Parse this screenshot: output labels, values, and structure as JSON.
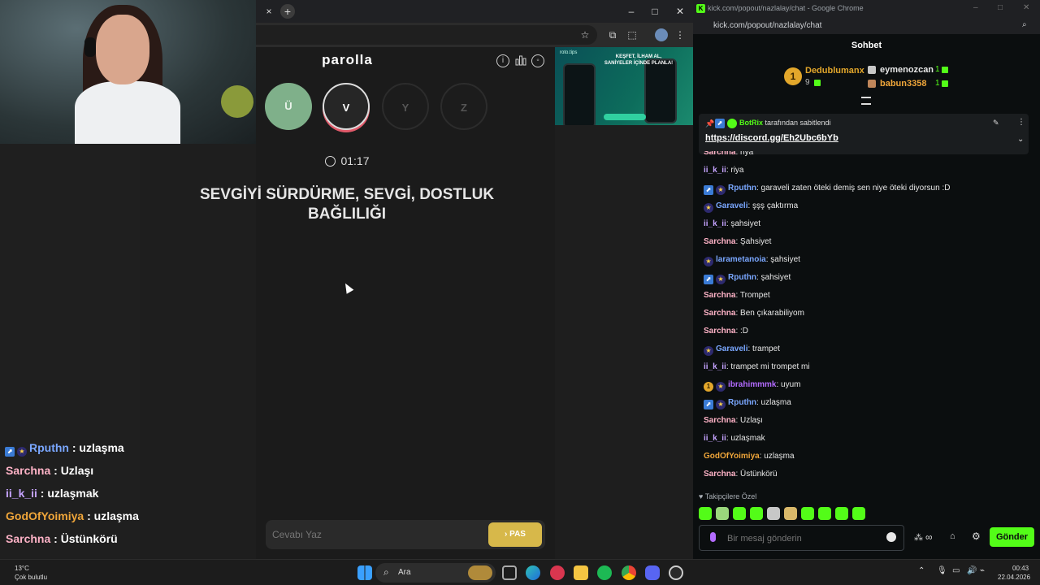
{
  "browser_left": {
    "tab_close": "×",
    "tab_new": "+",
    "win_min": "–",
    "win_max": "□",
    "win_close": "✕"
  },
  "parolla": {
    "title": "parolla",
    "letters": [
      "Ü",
      "V",
      "Y",
      "Z"
    ],
    "timer": "01:17",
    "question": "SEVGİYİ SÜRDÜRME, SEVGİ, DOSTLUK BAĞLILIĞI",
    "answer_placeholder": "Cevabı Yaz",
    "pas_label": "› PAS"
  },
  "ad": {
    "brand": "roto.tips",
    "title": "KEŞFET, İLHAM AL, SANİYELER İÇİNDE PLANLA!"
  },
  "overlay_chat": [
    {
      "user": "Rputhn",
      "text": " : uzlaşma",
      "color": "#7aa7ff"
    },
    {
      "user": "Sarchna",
      "text": " : Uzlaşı",
      "color": "#ffb3c7"
    },
    {
      "user": "ii_k_ii",
      "text": " : uzlaşmak",
      "color": "#c5a3ff"
    },
    {
      "user": "GodOfYoimiya",
      "text": " : uzlaşma",
      "color": "#f0a63a"
    },
    {
      "user": "Sarchna",
      "text": " : Üstünkörü",
      "color": "#ffb3c7"
    }
  ],
  "chat": {
    "window_title": "kick.com/popout/nazlalay/chat - Google Chrome",
    "url": "kick.com/popout/nazlalay/chat",
    "header": "Sohbet",
    "leaders": {
      "first": {
        "rank": "1",
        "name": "Dedublumanx",
        "count": "9"
      },
      "second": {
        "name": "eymenozcan",
        "count": "1"
      },
      "third": {
        "name": "babun3358",
        "count": "1"
      }
    },
    "pinned": {
      "by": "BotRix",
      "by_suffix": " tarafından sabitlendi",
      "link": "https://discord.gg/Eh2Ubc6bYb"
    },
    "messages": [
      {
        "user": "Sarchna",
        "text": ": riya",
        "color": "#ffb3c7",
        "badges": ""
      },
      {
        "user": "ii_k_ii",
        "text": ": riya",
        "color": "#c5a3ff",
        "badges": ""
      },
      {
        "user": "Rputhn",
        "text": ": garaveli zaten öteki demiş sen niye öteki diyorsun :D",
        "color": "#7aa7ff",
        "badges": "bot-star"
      },
      {
        "user": "Garaveli",
        "text": ": şşş çaktırma",
        "color": "#7aa7ff",
        "badges": "star"
      },
      {
        "user": "ii_k_ii",
        "text": ": şahsiyet",
        "color": "#c5a3ff",
        "badges": ""
      },
      {
        "user": "Sarchna",
        "text": ": Şahsiyet",
        "color": "#ffb3c7",
        "badges": ""
      },
      {
        "user": "larametanoia",
        "text": ": şahsiyet",
        "color": "#7aa7ff",
        "badges": "star"
      },
      {
        "user": "Rputhn",
        "text": ": şahsiyet",
        "color": "#7aa7ff",
        "badges": "bot-star"
      },
      {
        "user": "Sarchna",
        "text": ": Trompet",
        "color": "#ffb3c7",
        "badges": ""
      },
      {
        "user": "Sarchna",
        "text": ": Ben çıkarabiliyom",
        "color": "#ffb3c7",
        "badges": ""
      },
      {
        "user": "Sarchna",
        "text": ": :D",
        "color": "#ffb3c7",
        "badges": ""
      },
      {
        "user": "Garaveli",
        "text": ": trampet",
        "color": "#7aa7ff",
        "badges": "star"
      },
      {
        "user": "ii_k_ii",
        "text": ": trampet mi trompet mi",
        "color": "#c5a3ff",
        "badges": ""
      },
      {
        "user": "ibrahimmmk",
        "text": ": uyum",
        "color": "#b36bff",
        "badges": "one-star"
      },
      {
        "user": "Rputhn",
        "text": ": uzlaşma",
        "color": "#7aa7ff",
        "badges": "bot-star"
      },
      {
        "user": "Sarchna",
        "text": ": Uzlaşı",
        "color": "#ffb3c7",
        "badges": ""
      },
      {
        "user": "ii_k_ii",
        "text": ": uzlaşmak",
        "color": "#c5a3ff",
        "badges": ""
      },
      {
        "user": "GodOfYoimiya",
        "text": ": uzlaşma",
        "color": "#f0a63a",
        "badges": ""
      },
      {
        "user": "Sarchna",
        "text": ": Üstünkörü",
        "color": "#ffb3c7",
        "badges": ""
      }
    ],
    "followers_only": "Takipçilere Özel",
    "input_placeholder": "Bir mesaj gönderin",
    "send_label": "Gönder"
  },
  "taskbar": {
    "temp": "13°C",
    "weather": "Çok bulutlu",
    "search_label": "Ara",
    "time": "00:43",
    "date": "22.04.2026"
  },
  "colors": {
    "kick_green": "#53fc18",
    "pas_gold": "#d7b84a",
    "letter_done": "#7fb08a"
  }
}
